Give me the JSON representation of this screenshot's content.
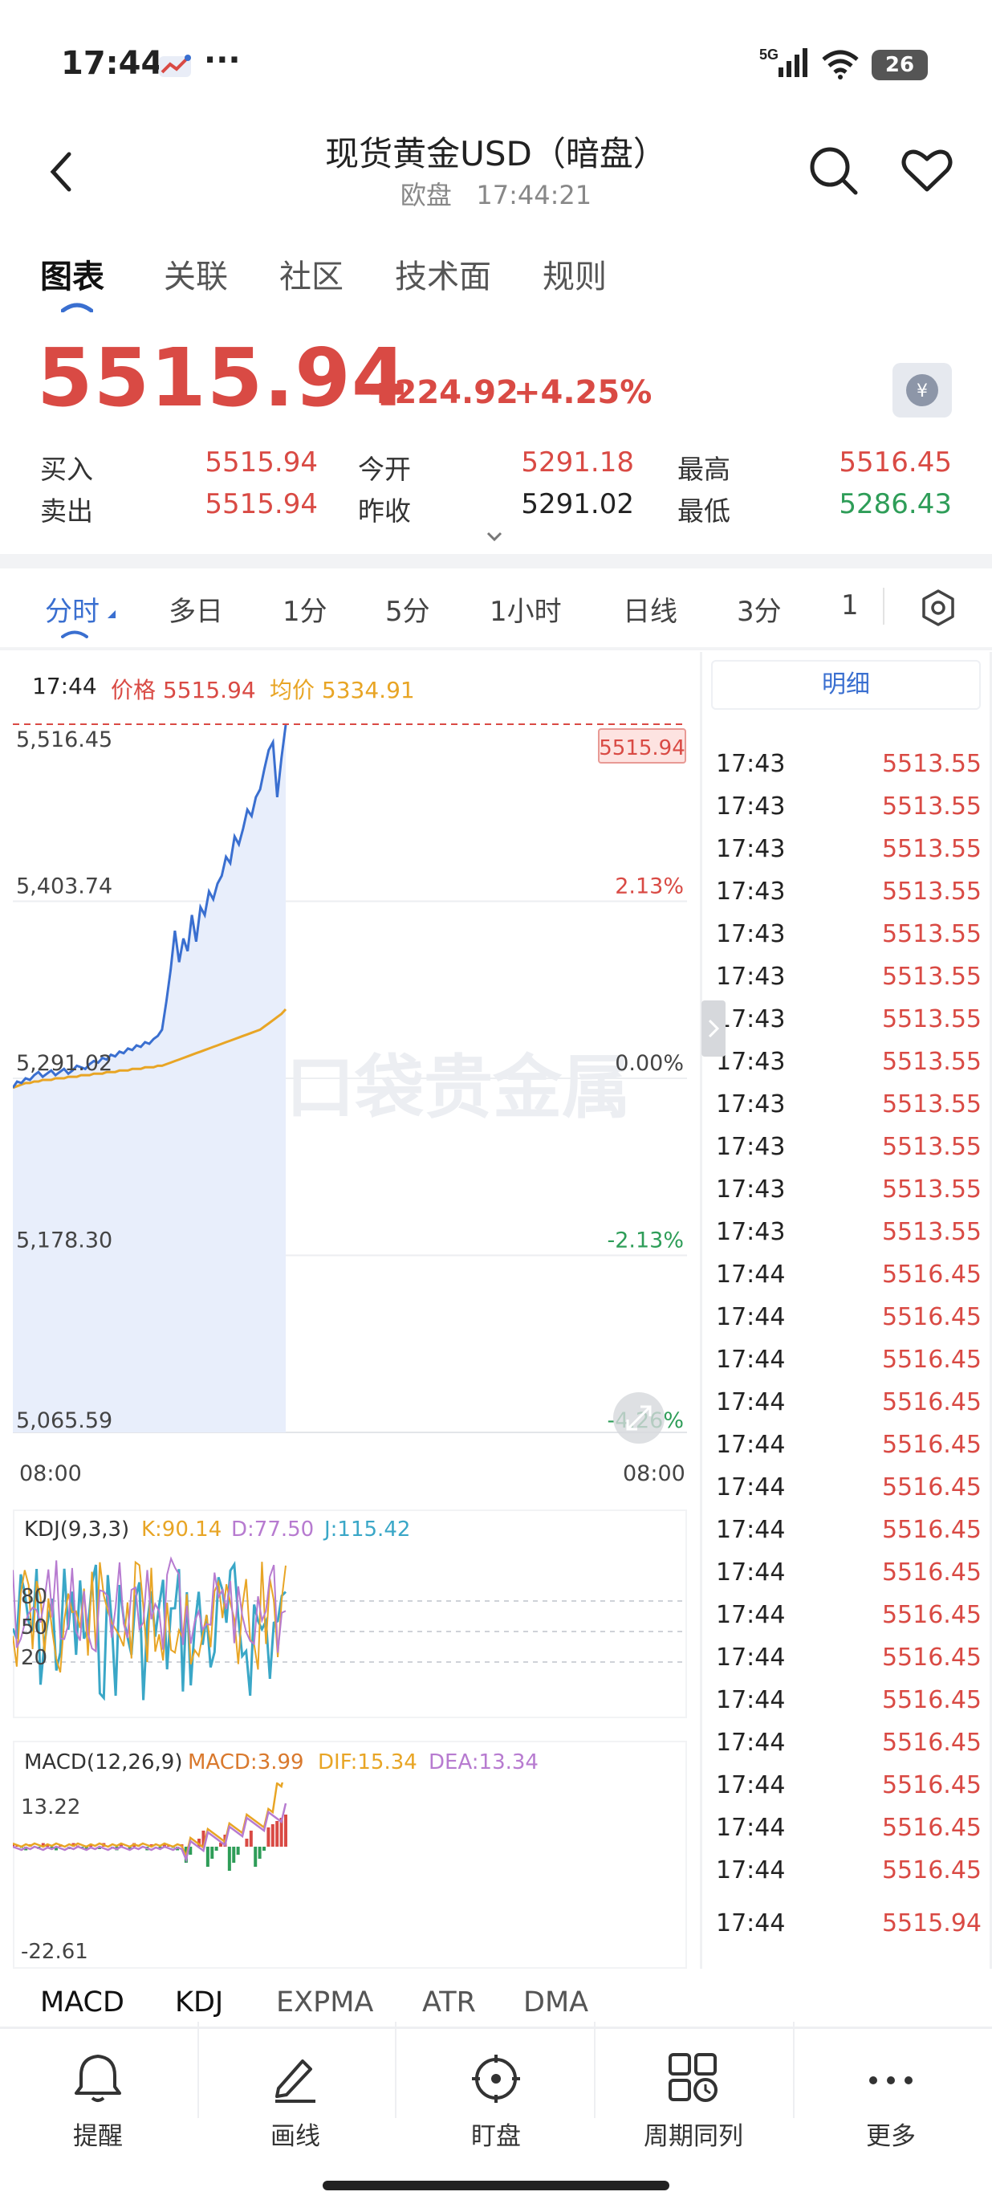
{
  "status_bar": {
    "time": "17:44",
    "dots": "···",
    "network": "5G",
    "battery": "26"
  },
  "header": {
    "title": "现货黄金USD（暗盘）",
    "session": "欧盘",
    "time": "17:44:21"
  },
  "tabs": [
    {
      "label": "图表"
    },
    {
      "label": "关联"
    },
    {
      "label": "社区"
    },
    {
      "label": "技术面"
    },
    {
      "label": "规则"
    }
  ],
  "quote": {
    "price": "5515.94",
    "change": "+224.92",
    "change_pct": "+4.25%",
    "bid_label": "买入",
    "bid": "5515.94",
    "ask_label": "卖出",
    "ask": "5515.94",
    "open_label": "今开",
    "open": "5291.18",
    "prev_close_label": "昨收",
    "prev_close": "5291.02",
    "high_label": "最高",
    "high": "5516.45",
    "low_label": "最低",
    "low": "5286.43"
  },
  "periods": [
    {
      "label": "分时"
    },
    {
      "label": "多日"
    },
    {
      "label": "1分"
    },
    {
      "label": "5分"
    },
    {
      "label": "1小时"
    },
    {
      "label": "日线"
    },
    {
      "label": "3分"
    },
    {
      "label": "1"
    }
  ],
  "chart_info": {
    "time": "17:44",
    "price_label": "价格",
    "price": "5515.94",
    "avg_label": "均价",
    "avg": "5334.91",
    "current_tag": "5515.94",
    "time_start": "08:00",
    "time_end": "08:00",
    "watermark": "口袋贵金属"
  },
  "chart_data": {
    "type": "line",
    "y_ticks": [
      "5,516.45",
      "5,403.74",
      "5,291.02",
      "5,178.30",
      "5,065.59"
    ],
    "pct_ticks": [
      "4.26%",
      "2.13%",
      "0.00%",
      "-2.13%",
      "-4.26%"
    ],
    "ylim": [
      5065.59,
      5516.45
    ],
    "x_ticks": [
      "08:00",
      "08:00"
    ],
    "series": [
      {
        "name": "价格",
        "values": [
          5285,
          5289,
          5288,
          5291,
          5290,
          5293,
          5295,
          5292,
          5294,
          5296,
          5293,
          5295,
          5297,
          5294,
          5296,
          5299,
          5298,
          5297,
          5300,
          5302,
          5301,
          5304,
          5303,
          5306,
          5305,
          5308,
          5307,
          5310,
          5309,
          5312,
          5311,
          5314,
          5313,
          5316,
          5318,
          5322,
          5340,
          5360,
          5385,
          5365,
          5380,
          5372,
          5395,
          5378,
          5400,
          5395,
          5410,
          5405,
          5415,
          5420,
          5432,
          5428,
          5445,
          5440,
          5450,
          5462,
          5458,
          5470,
          5475,
          5488,
          5500,
          5505,
          5470,
          5495,
          5516
        ]
      },
      {
        "name": "均价",
        "values": [
          5285,
          5286,
          5287,
          5288,
          5288,
          5289,
          5289,
          5290,
          5290,
          5290,
          5291,
          5291,
          5291,
          5292,
          5292,
          5292,
          5293,
          5293,
          5293,
          5294,
          5294,
          5294,
          5295,
          5295,
          5295,
          5296,
          5296,
          5296,
          5297,
          5297,
          5297,
          5298,
          5298,
          5298,
          5299,
          5299,
          5300,
          5301,
          5302,
          5303,
          5304,
          5305,
          5306,
          5307,
          5308,
          5309,
          5310,
          5311,
          5312,
          5313,
          5314,
          5315,
          5316,
          5317,
          5318,
          5319,
          5320,
          5321,
          5322,
          5324,
          5326,
          5328,
          5330,
          5332,
          5335
        ]
      }
    ]
  },
  "kdj": {
    "label": "KDJ(9,3,3)",
    "k": "K:90.14",
    "d": "D:77.50",
    "j": "J:115.42",
    "levels": [
      "80",
      "50",
      "20"
    ]
  },
  "macd": {
    "label": "MACD(12,26,9)",
    "macd": "MACD:3.99",
    "dif": "DIF:15.34",
    "dea": "DEA:13.34",
    "max": "13.22",
    "min": "-22.61"
  },
  "indicator_tabs": [
    {
      "label": "MACD"
    },
    {
      "label": "KDJ"
    },
    {
      "label": "EXPMA"
    },
    {
      "label": "ATR"
    },
    {
      "label": "DMA"
    }
  ],
  "detail": {
    "title": "明细",
    "rows": [
      {
        "t": "17:43",
        "p": "5513.55"
      },
      {
        "t": "17:43",
        "p": "5513.55"
      },
      {
        "t": "17:43",
        "p": "5513.55"
      },
      {
        "t": "17:43",
        "p": "5513.55"
      },
      {
        "t": "17:43",
        "p": "5513.55"
      },
      {
        "t": "17:43",
        "p": "5513.55"
      },
      {
        "t": "17:43",
        "p": "5513.55"
      },
      {
        "t": "17:43",
        "p": "5513.55"
      },
      {
        "t": "17:43",
        "p": "5513.55"
      },
      {
        "t": "17:43",
        "p": "5513.55"
      },
      {
        "t": "17:43",
        "p": "5513.55"
      },
      {
        "t": "17:43",
        "p": "5513.55"
      },
      {
        "t": "17:44",
        "p": "5516.45"
      },
      {
        "t": "17:44",
        "p": "5516.45"
      },
      {
        "t": "17:44",
        "p": "5516.45"
      },
      {
        "t": "17:44",
        "p": "5516.45"
      },
      {
        "t": "17:44",
        "p": "5516.45"
      },
      {
        "t": "17:44",
        "p": "5516.45"
      },
      {
        "t": "17:44",
        "p": "5516.45"
      },
      {
        "t": "17:44",
        "p": "5516.45"
      },
      {
        "t": "17:44",
        "p": "5516.45"
      },
      {
        "t": "17:44",
        "p": "5516.45"
      },
      {
        "t": "17:44",
        "p": "5516.45"
      },
      {
        "t": "17:44",
        "p": "5516.45"
      },
      {
        "t": "17:44",
        "p": "5516.45"
      },
      {
        "t": "17:44",
        "p": "5516.45"
      },
      {
        "t": "17:44",
        "p": "5516.45"
      },
      {
        "t": "17:44",
        "p": "5515.94"
      }
    ]
  },
  "bottom_nav": [
    {
      "label": "提醒",
      "icon": "bell-icon"
    },
    {
      "label": "画线",
      "icon": "pen-icon"
    },
    {
      "label": "盯盘",
      "icon": "target-icon"
    },
    {
      "label": "周期同列",
      "icon": "grid-clock-icon"
    },
    {
      "label": "更多",
      "icon": "more-icon"
    }
  ],
  "colors": {
    "up": "#d94a44",
    "down": "#2e9d58",
    "accent": "#3a6fd0",
    "avg_line": "#e8a525"
  }
}
